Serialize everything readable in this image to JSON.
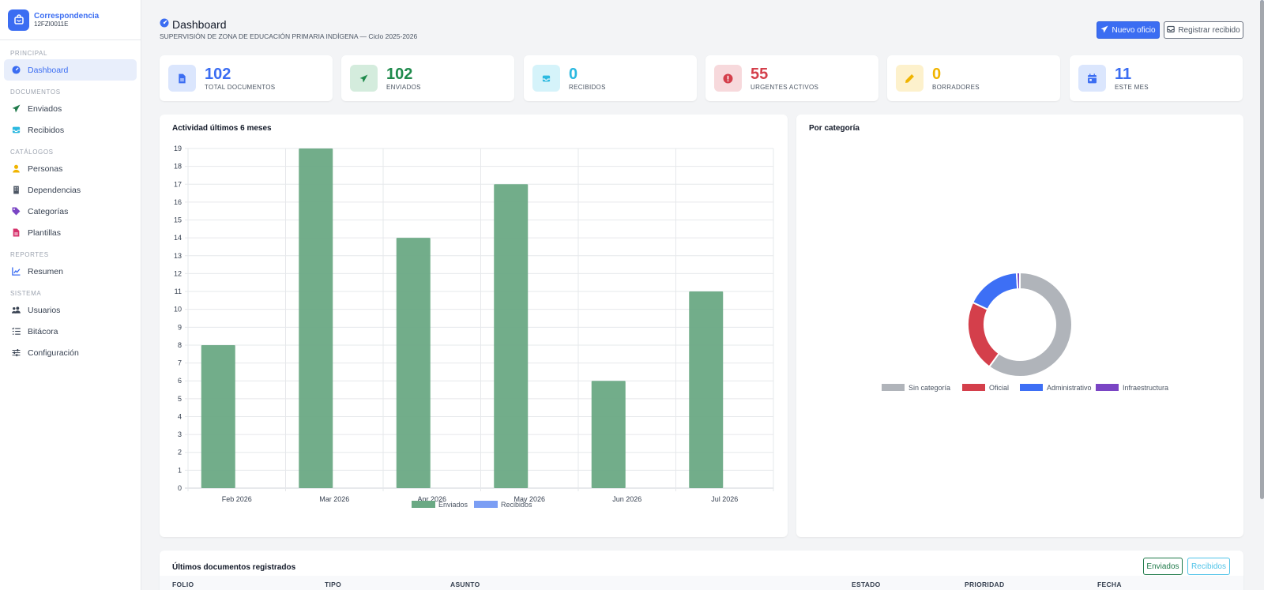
{
  "sidebar": {
    "brand_title": "Correspondencia",
    "brand_code": "12FZI0011E",
    "sections": [
      {
        "label": "PRINCIPAL",
        "items": [
          {
            "label": "Dashboard",
            "icon": "dashboard-icon",
            "active": true
          }
        ]
      },
      {
        "label": "DOCUMENTOS",
        "items": [
          {
            "label": "Enviados",
            "icon": "paper-plane-icon"
          },
          {
            "label": "Recibidos",
            "icon": "inbox-icon"
          }
        ]
      },
      {
        "label": "CATÁLOGOS",
        "items": [
          {
            "label": "Personas",
            "icon": "person-icon"
          },
          {
            "label": "Dependencias",
            "icon": "building-icon"
          },
          {
            "label": "Categorías",
            "icon": "tags-icon"
          },
          {
            "label": "Plantillas",
            "icon": "file-icon"
          }
        ]
      },
      {
        "label": "REPORTES",
        "items": [
          {
            "label": "Resumen",
            "icon": "chart-icon"
          }
        ]
      },
      {
        "label": "SISTEMA",
        "items": [
          {
            "label": "Usuarios",
            "icon": "users-icon"
          },
          {
            "label": "Bitácora",
            "icon": "list-icon"
          },
          {
            "label": "Configuración",
            "icon": "sliders-icon"
          }
        ]
      }
    ]
  },
  "header": {
    "title": "Dashboard",
    "subtitle": "SUPERVISIÓN DE ZONA DE EDUCACIÓN PRIMARIA INDÍGENA — Ciclo 2025-2026",
    "btn_new": "Nuevo oficio",
    "btn_register": "Registrar recibido"
  },
  "stats": [
    {
      "value": "102",
      "label": "TOTAL DOCUMENTOS",
      "color": "#3b6df2",
      "bg": "#dbe6fd",
      "icon": "document-icon"
    },
    {
      "value": "102",
      "label": "ENVIADOS",
      "color": "#1f8a4c",
      "bg": "#d4ecdd",
      "icon": "paper-plane-icon"
    },
    {
      "value": "0",
      "label": "RECIBIDOS",
      "color": "#2cb9e0",
      "bg": "#d5f3fa",
      "icon": "inbox-icon"
    },
    {
      "value": "55",
      "label": "URGENTES ACTIVOS",
      "color": "#d43f4b",
      "bg": "#f7d9dc",
      "icon": "alert-icon"
    },
    {
      "value": "0",
      "label": "BORRADORES",
      "color": "#f0b400",
      "bg": "#fdf1cc",
      "icon": "pencil-icon"
    },
    {
      "value": "11",
      "label": "ESTE MES",
      "color": "#3b6df2",
      "bg": "#dbe6fd",
      "icon": "calendar-icon"
    }
  ],
  "activity_title": "Actividad últimos 6 meses",
  "category_title": "Por categoría",
  "chart_data": [
    {
      "type": "bar",
      "title": "Actividad últimos 6 meses",
      "categories": [
        "Feb 2026",
        "Mar 2026",
        "Apr 2026",
        "May 2026",
        "Jun 2026",
        "Jul 2026"
      ],
      "series": [
        {
          "name": "Enviados",
          "values": [
            8,
            19,
            14,
            17,
            6,
            11
          ],
          "color": "#6aa984"
        },
        {
          "name": "Recibidos",
          "values": [
            0,
            0,
            0,
            0,
            0,
            0
          ],
          "color": "#7b9ef4"
        }
      ],
      "ylim": [
        0,
        19
      ],
      "yticks": [
        0,
        1,
        2,
        3,
        4,
        5,
        6,
        7,
        8,
        9,
        10,
        11,
        12,
        13,
        14,
        15,
        16,
        17,
        18,
        19
      ],
      "grid": true,
      "legend": "bottom"
    },
    {
      "type": "pie",
      "title": "Por categoría",
      "labels": [
        "Sin categoría",
        "Oficial",
        "Administrativo",
        "Infraestructura"
      ],
      "values": [
        60,
        22,
        17,
        1
      ],
      "colors": [
        "#b0b4ba",
        "#d43f4b",
        "#3d6ff5",
        "#7a45c4"
      ],
      "legend": "bottom"
    }
  ],
  "table": {
    "title": "Últimos documentos registrados",
    "tab_sent": "Enviados",
    "tab_received": "Recibidos",
    "columns": [
      "FOLIO",
      "TIPO",
      "ASUNTO",
      "ESTADO",
      "PRIORIDAD",
      "FECHA"
    ]
  }
}
